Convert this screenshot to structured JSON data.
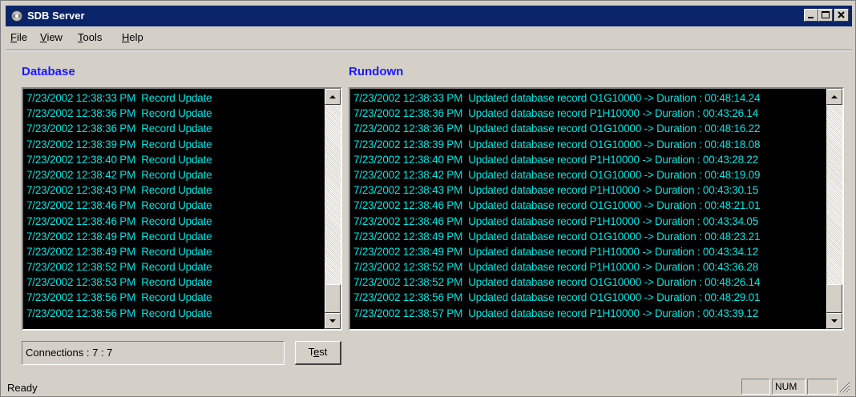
{
  "window": {
    "title": "SDB Server"
  },
  "menu": [
    {
      "label": "File",
      "accel": "F",
      "rest": "ile"
    },
    {
      "label": "View",
      "accel": "V",
      "rest": "iew"
    },
    {
      "label": "Tools",
      "accel": "T",
      "rest": "ools"
    },
    {
      "label": "Help",
      "accel": "H",
      "rest": "elp"
    }
  ],
  "database": {
    "title": "Database",
    "rows": [
      "7/23/2002 12:38:33 PM  Record Update",
      "7/23/2002 12:38:36 PM  Record Update",
      "7/23/2002 12:38:36 PM  Record Update",
      "7/23/2002 12:38:39 PM  Record Update",
      "7/23/2002 12:38:40 PM  Record Update",
      "7/23/2002 12:38:42 PM  Record Update",
      "7/23/2002 12:38:43 PM  Record Update",
      "7/23/2002 12:38:46 PM  Record Update",
      "7/23/2002 12:38:46 PM  Record Update",
      "7/23/2002 12:38:49 PM  Record Update",
      "7/23/2002 12:38:49 PM  Record Update",
      "7/23/2002 12:38:52 PM  Record Update",
      "7/23/2002 12:38:53 PM  Record Update",
      "7/23/2002 12:38:56 PM  Record Update",
      "7/23/2002 12:38:56 PM  Record Update"
    ]
  },
  "rundown": {
    "title": "Rundown",
    "rows": [
      "7/23/2002 12:38:33 PM  Updated database record O1G10000 -> Duration : 00:48:14.24",
      "7/23/2002 12:38:36 PM  Updated database record P1H10000 -> Duration : 00:43:26.14",
      "7/23/2002 12:38:36 PM  Updated database record O1G10000 -> Duration : 00:48:16.22",
      "7/23/2002 12:38:39 PM  Updated database record O1G10000 -> Duration : 00:48:18.08",
      "7/23/2002 12:38:40 PM  Updated database record P1H10000 -> Duration : 00:43:28.22",
      "7/23/2002 12:38:42 PM  Updated database record O1G10000 -> Duration : 00:48:19.09",
      "7/23/2002 12:38:43 PM  Updated database record P1H10000 -> Duration : 00:43:30.15",
      "7/23/2002 12:38:46 PM  Updated database record O1G10000 -> Duration : 00:48:21.01",
      "7/23/2002 12:38:46 PM  Updated database record P1H10000 -> Duration : 00:43:34.05",
      "7/23/2002 12:38:49 PM  Updated database record O1G10000 -> Duration : 00:48:23.21",
      "7/23/2002 12:38:49 PM  Updated database record P1H10000 -> Duration : 00:43:34.12",
      "7/23/2002 12:38:52 PM  Updated database record P1H10000 -> Duration : 00:43:36.28",
      "7/23/2002 12:38:52 PM  Updated database record O1G10000 -> Duration : 00:48:26.14",
      "7/23/2002 12:38:56 PM  Updated database record O1G10000 -> Duration : 00:48:29.01",
      "7/23/2002 12:38:57 PM  Updated database record P1H10000 -> Duration : 00:43:39.12"
    ]
  },
  "connections": {
    "text": "Connections : 7 : 7"
  },
  "test_button": {
    "accel": "e",
    "before": "T",
    "after": "st"
  },
  "statusbar": {
    "text": "Ready",
    "num": "NUM"
  },
  "colors": {
    "title_bar": "#0a246a",
    "section_title": "#1a1aff",
    "log_text": "#00e5e5",
    "log_bg": "#000000",
    "face": "#d4d0c8"
  },
  "icons": [
    "app-icon",
    "minimize-icon",
    "maximize-icon",
    "close-icon",
    "scroll-up-icon",
    "scroll-down-icon",
    "size-grip-icon"
  ]
}
